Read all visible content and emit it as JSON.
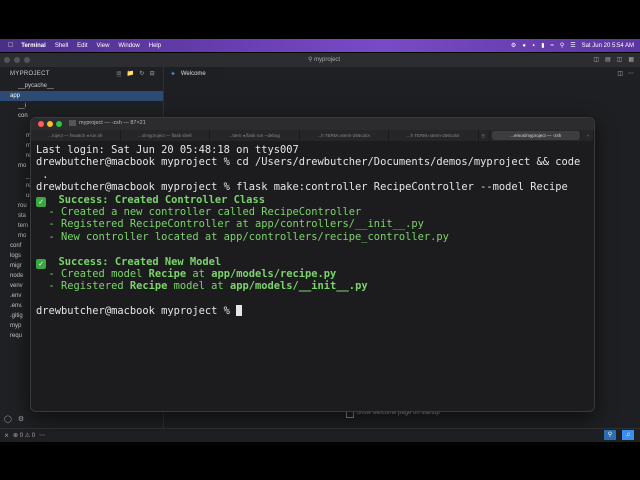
{
  "menubar": {
    "app_name": "Terminal",
    "items": [
      "Shell",
      "Edit",
      "View",
      "Window",
      "Help"
    ],
    "datetime": "Sat Jun 20  5:54 AM"
  },
  "vscode": {
    "search_placeholder": "myproject",
    "explorer_title": "MYPROJECT",
    "tree": [
      {
        "label": "__pycache__",
        "indent": 1
      },
      {
        "label": "app",
        "indent": 0,
        "selected": true
      },
      {
        "label": "__i",
        "indent": 1
      },
      {
        "label": "con",
        "indent": 1
      },
      {
        "label": "",
        "indent": 2
      },
      {
        "label": "m",
        "indent": 2
      },
      {
        "label": "m",
        "indent": 2
      },
      {
        "label": "re",
        "indent": 2
      },
      {
        "label": "mo",
        "indent": 1
      },
      {
        "label": "_",
        "indent": 2
      },
      {
        "label": "re",
        "indent": 2
      },
      {
        "label": "us",
        "indent": 2
      },
      {
        "label": "rou",
        "indent": 1
      },
      {
        "label": "sta",
        "indent": 1
      },
      {
        "label": "tem",
        "indent": 1
      },
      {
        "label": "mo",
        "indent": 1
      },
      {
        "label": "conf",
        "indent": 0
      },
      {
        "label": "logs",
        "indent": 0
      },
      {
        "label": "migr",
        "indent": 0
      },
      {
        "label": "node",
        "indent": 0
      },
      {
        "label": "venv",
        "indent": 0
      },
      {
        "label": ".env",
        "indent": 0
      },
      {
        "label": ".env.",
        "indent": 0
      },
      {
        "label": ".gitig",
        "indent": 0
      },
      {
        "label": "myp",
        "indent": 0
      },
      {
        "label": "requ",
        "indent": 0
      }
    ],
    "tab_welcome": "Welcome",
    "welcome_checkbox_label": "Show welcome page on startup",
    "status": {
      "errors": "0",
      "warnings": "0"
    }
  },
  "terminal": {
    "title": "myproject — -zsh — 87×21",
    "tabs": [
      "...roject — fswatch ◂ run.sh",
      "...s/myproject — flask shell",
      "...ttern ◂ flask run --debug",
      "...h TERM=xterm-256color",
      "...h TERM=xterm-256color",
      "...emos/myproject — -zsh"
    ],
    "active_tab": 5,
    "lines": {
      "l1": "Last login: Sat Jun 20 05:48:18 on ttys007",
      "l2": "drewbutcher@macbook myproject % cd /Users/drewbutcher/Documents/demos/myproject && code",
      "l3": " .",
      "l4": "drewbutcher@macbook myproject % flask make:controller RecipeController --model Recipe",
      "s1_title": "Success: Created Controller Class",
      "s1_a": "  - Created a new controller called RecipeController",
      "s1_b": "  - Registered RecipeController at app/controllers/__init__.py",
      "s1_c": "  - New controller located at app/controllers/recipe_controller.py",
      "s2_title": "Success: Created New Model",
      "s2_a_pre": "  - Created model ",
      "s2_a_b1": "Recipe",
      "s2_a_mid": " at ",
      "s2_a_b2": "app/models/recipe.py",
      "s2_b_pre": "  - Registered ",
      "s2_b_b1": "Recipe",
      "s2_b_mid": " model at ",
      "s2_b_b2": "app/models/__init__.py",
      "prompt": "drewbutcher@macbook myproject % "
    }
  }
}
